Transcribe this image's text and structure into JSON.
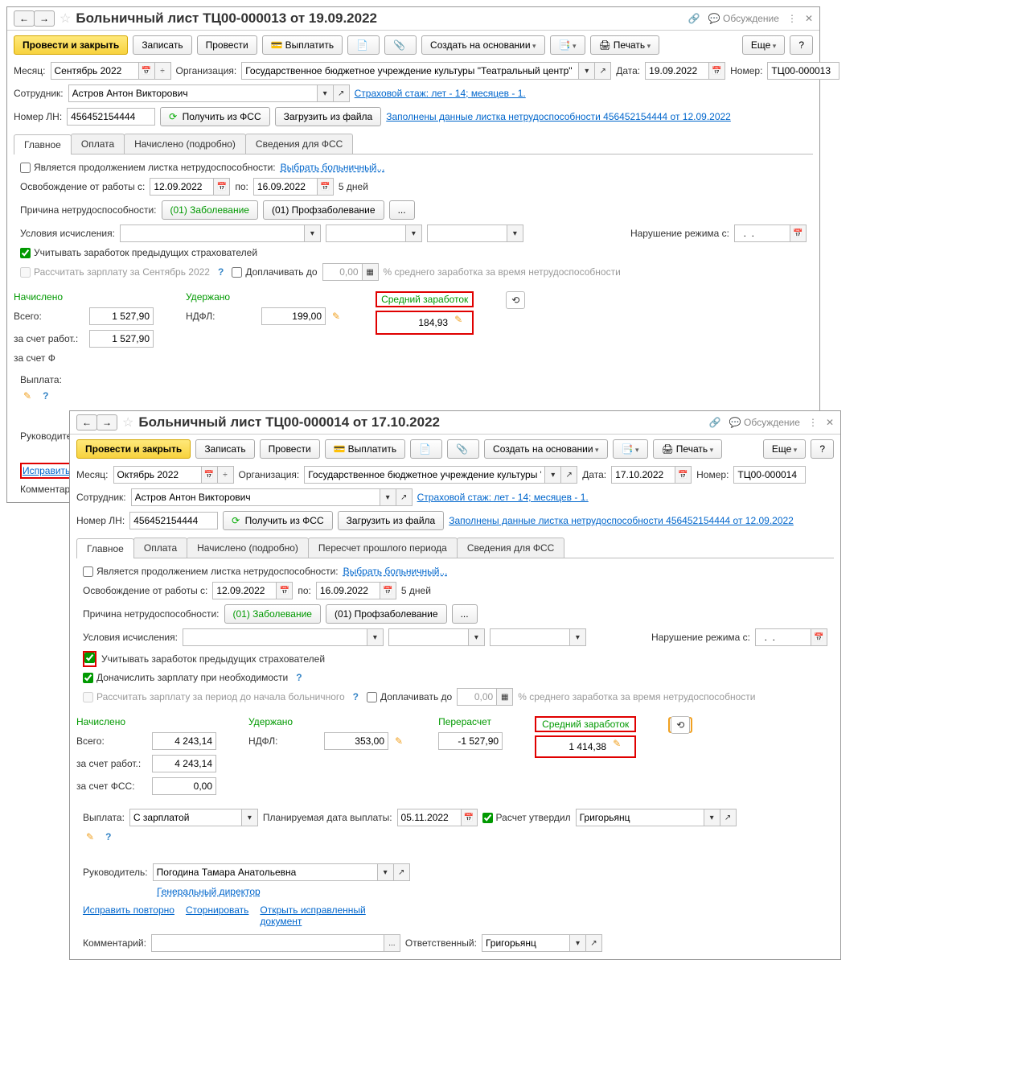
{
  "w1": {
    "title": "Больничный лист ТЦ00-000013 от 19.09.2022",
    "discuss": "Обсуждение",
    "toolbar": {
      "post_close": "Провести и закрыть",
      "write": "Записать",
      "post": "Провести",
      "pay": "Выплатить",
      "create": "Создать на основании",
      "print": "Печать",
      "more": "Еще"
    },
    "month_lbl": "Месяц:",
    "month": "Сентябрь 2022",
    "org_lbl": "Организация:",
    "org": "Государственное бюджетное учреждение культуры \"Театральный центр\"",
    "date_lbl": "Дата:",
    "date": "19.09.2022",
    "num_lbl": "Номер:",
    "num": "ТЦ00-000013",
    "emp_lbl": "Сотрудник:",
    "emp": "Астров Антон Викторович",
    "insurance_link": "Страховой стаж: лет - 14; месяцев - 1.",
    "ln_lbl": "Номер ЛН:",
    "ln": "456452154444",
    "get_fss": "Получить из ФСС",
    "load_file": "Загрузить из файла",
    "filled_link": "Заполнены данные листка нетрудоспособности 456452154444 от 12.09.2022",
    "tabs": [
      "Главное",
      "Оплата",
      "Начислено (подробно)",
      "Сведения для ФСС"
    ],
    "cont_lbl": "Является продолжением листка нетрудоспособности:",
    "cont_link": "Выбрать больничный...",
    "free_lbl": "Освобождение от работы с:",
    "free_from": "12.09.2022",
    "free_to_lbl": "по:",
    "free_to": "16.09.2022",
    "days": "5 дней",
    "cause_lbl": "Причина нетрудоспособности:",
    "cause1": "(01) Заболевание",
    "cause2": "(01) Профзаболевание",
    "cond_lbl": "Условия исчисления:",
    "viol_lbl": "Нарушение режима с:",
    "viol_date": "  .  .    ",
    "prev_ins_lbl": "Учитывать заработок предыдущих страхователей",
    "recalc_lbl": "Рассчитать зарплату за Сентябрь 2022",
    "topup_lbl": "Доплачивать до",
    "topup_val": "0,00",
    "topup_after": "% среднего заработка за время нетрудоспособности",
    "accr": "Начислено",
    "withh": "Удержано",
    "avg": "Средний заработок",
    "total_lbl": "Всего:",
    "total": "1 527,90",
    "ndfl_lbl": "НДФЛ:",
    "ndfl": "199,00",
    "avg_val": "184,93",
    "emp_part_lbl": "за счет работ.:",
    "emp_part": "1 527,90",
    "fss_part_lbl": "за счет Ф",
    "payout_lbl": "Выплата:",
    "mgr_lbl": "Руководитель",
    "fix_link": "Исправить",
    "comment_lbl": "Комментари"
  },
  "w2": {
    "title": "Больничный лист ТЦ00-000014 от 17.10.2022",
    "discuss": "Обсуждение",
    "toolbar": {
      "post_close": "Провести и закрыть",
      "write": "Записать",
      "post": "Провести",
      "pay": "Выплатить",
      "create": "Создать на основании",
      "print": "Печать",
      "more": "Еще"
    },
    "month_lbl": "Месяц:",
    "month": "Октябрь 2022",
    "org_lbl": "Организация:",
    "org": "Государственное бюджетное учреждение культуры \"Театральн",
    "date_lbl": "Дата:",
    "date": "17.10.2022",
    "num_lbl": "Номер:",
    "num": "ТЦ00-000014",
    "emp_lbl": "Сотрудник:",
    "emp": "Астров Антон Викторович",
    "insurance_link": "Страховой стаж: лет - 14; месяцев - 1.",
    "ln_lbl": "Номер ЛН:",
    "ln": "456452154444",
    "get_fss": "Получить из ФСС",
    "load_file": "Загрузить из файла",
    "filled_link": "Заполнены данные листка нетрудоспособности 456452154444 от 12.09.2022",
    "tabs": [
      "Главное",
      "Оплата",
      "Начислено (подробно)",
      "Пересчет прошлого периода",
      "Сведения для ФСС"
    ],
    "cont_lbl": "Является продолжением листка нетрудоспособности:",
    "cont_link": "Выбрать больничный...",
    "free_lbl": "Освобождение от работы с:",
    "free_from": "12.09.2022",
    "free_to_lbl": "по:",
    "free_to": "16.09.2022",
    "days": "5 дней",
    "cause_lbl": "Причина нетрудоспособности:",
    "cause1": "(01) Заболевание",
    "cause2": "(01) Профзаболевание",
    "cond_lbl": "Условия исчисления:",
    "viol_lbl": "Нарушение режима с:",
    "viol_date": "  .  .    ",
    "prev_ins_lbl": "Учитывать заработок предыдущих страхователей",
    "extra_accr_lbl": "Доначислить зарплату при необходимости",
    "recalc_lbl": "Рассчитать зарплату за период до начала больничного",
    "topup_lbl": "Доплачивать до",
    "topup_val": "0,00",
    "topup_after": "% среднего заработка за время нетрудоспособности",
    "accr": "Начислено",
    "withh": "Удержано",
    "recalc": "Перерасчет",
    "avg": "Средний заработок",
    "total_lbl": "Всего:",
    "total": "4 243,14",
    "ndfl_lbl": "НДФЛ:",
    "ndfl": "353,00",
    "recalc_val": "-1 527,90",
    "avg_val": "1 414,38",
    "emp_part_lbl": "за счет работ.:",
    "emp_part": "4 243,14",
    "fss_part_lbl": "за счет ФСС:",
    "fss_part": "0,00",
    "payout_lbl": "Выплата:",
    "payout": "С зарплатой",
    "plan_lbl": "Планируемая дата выплаты:",
    "plan_date": "05.11.2022",
    "calc_ok_lbl": "Расчет утвердил",
    "calc_ok_by": "Григорьянц",
    "mgr_lbl": "Руководитель:",
    "mgr": "Погодина Тамара Анатольевна",
    "mgr_pos": "Генеральный директор",
    "fix_again": "Исправить повторно",
    "storno": "Сторнировать",
    "open_fixed": "Открыть исправленный документ",
    "comment_lbl": "Комментарий:",
    "resp_lbl": "Ответственный:",
    "resp": "Григорьянц"
  }
}
